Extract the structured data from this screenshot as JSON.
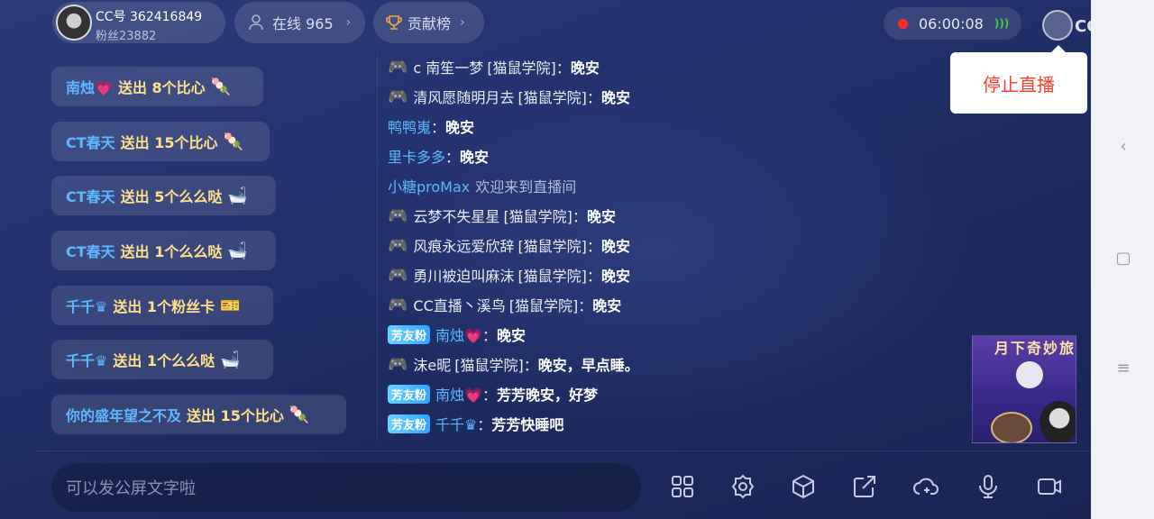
{
  "header": {
    "anchor_id": "CC号 362416849",
    "anchor_fans": "粉丝23882",
    "online_label": "在线 965",
    "rank_label": "贡献榜",
    "timer": "06:00:08",
    "logo_text": "CC直播"
  },
  "popup": {
    "stop_label": "停止直播"
  },
  "gifts": [
    {
      "name": "南烛💗",
      "action": "送出 8个比心",
      "icon": "🍡"
    },
    {
      "name": "CT春天",
      "action": "送出 15个比心",
      "icon": "🍡"
    },
    {
      "name": "CT春天",
      "action": "送出 5个么么哒",
      "icon": "🛁"
    },
    {
      "name": "CT春天",
      "action": "送出 1个么么哒",
      "icon": "🛁"
    },
    {
      "name": "千千♛",
      "action": "送出 1个粉丝卡",
      "icon": "🎫"
    },
    {
      "name": "千千♛",
      "action": "送出 1个么么哒",
      "icon": "🛁"
    },
    {
      "name": "你的盛年望之不及",
      "action": "送出 15个比心",
      "icon": "🍡"
    }
  ],
  "chat": [
    {
      "type": "game",
      "name": "c  南笙一梦",
      "tag": "[猫鼠学院]",
      "colon": "：",
      "msg": "晚安"
    },
    {
      "type": "game",
      "name": "清风愿随明月去",
      "tag": "[猫鼠学院]",
      "colon": "：",
      "msg": "晚安"
    },
    {
      "type": "plain",
      "name": "鸭鸭嵬",
      "colon": "：",
      "msg": "晚安"
    },
    {
      "type": "plain",
      "name": "里卡多多",
      "colon": "：",
      "msg": "晚安"
    },
    {
      "type": "welcome",
      "name": "小糖proMax",
      "msg": "欢迎来到直播间"
    },
    {
      "type": "game",
      "name": "云梦不失星星",
      "tag": "[猫鼠学院]",
      "colon": "：",
      "msg": "晚安"
    },
    {
      "type": "game",
      "name": "风痕永远爱欣辞",
      "tag": "[猫鼠学院]",
      "colon": "：",
      "msg": "晚安"
    },
    {
      "type": "game",
      "name": "勇川被迫叫麻沫",
      "tag": "[猫鼠学院]",
      "colon": "：",
      "msg": "晚安"
    },
    {
      "type": "game",
      "name": "CC直播丶溪鸟",
      "tag": "[猫鼠学院]",
      "colon": "：",
      "msg": "晚安"
    },
    {
      "type": "fan",
      "badge": "芳友粉",
      "name": "南烛💗",
      "colon": "：",
      "msg": "晚安"
    },
    {
      "type": "game",
      "name": "沫e昵",
      "tag": "[猫鼠学院]",
      "colon": "：",
      "msg": "晚安，早点睡。"
    },
    {
      "type": "fan",
      "badge": "芳友粉",
      "name": "南烛💗",
      "colon": "：",
      "msg": "芳芳晚安，好梦"
    },
    {
      "type": "fan",
      "badge": "芳友粉",
      "name": "千千♛",
      "colon": "：",
      "msg": "芳芳快睡吧"
    }
  ],
  "thumbnail": {
    "title": "月下奇妙旅"
  },
  "input": {
    "placeholder": "可以发公屏文字啦"
  },
  "toolbar": [
    "grid-icon",
    "settings-icon",
    "box-icon",
    "share-icon",
    "cloud-plus-icon",
    "mic-icon",
    "camera-icon"
  ],
  "colors": {
    "accent_blue": "#5fb8ff",
    "gift_yellow": "#ffe08a",
    "stop_red": "#ff3b30",
    "rec_red": "#ff2a2a"
  }
}
